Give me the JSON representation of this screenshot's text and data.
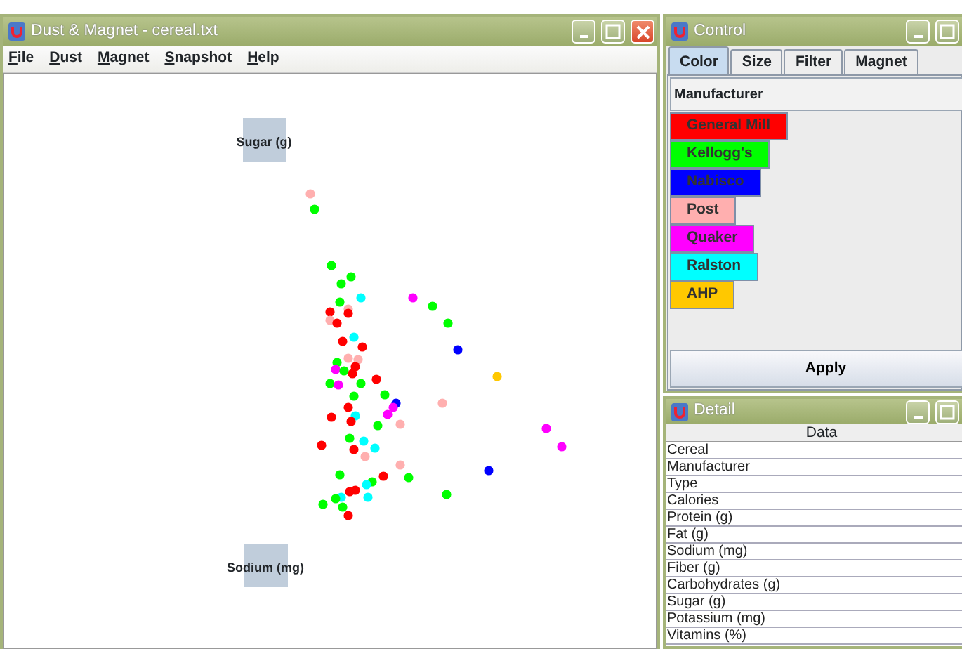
{
  "main_window": {
    "title": "Dust & Magnet - cereal.txt",
    "menu": [
      "File",
      "Dust",
      "Magnet",
      "Snapshot",
      "Help"
    ],
    "magnets": [
      {
        "label": "Sugar (g)"
      },
      {
        "label": "Sodium (mg)"
      }
    ]
  },
  "control_window": {
    "title": "Control",
    "tabs": [
      {
        "label": "Color",
        "selected": true
      },
      {
        "label": "Size",
        "selected": false
      },
      {
        "label": "Filter",
        "selected": false
      },
      {
        "label": "Magnet",
        "selected": false
      }
    ],
    "attribute": "Manufacturer",
    "legend": [
      {
        "label": "General Mill",
        "color": "#ff0000"
      },
      {
        "label": "Kellogg's",
        "color": "#00ff00"
      },
      {
        "label": "Nabisco",
        "color": "#0000ff"
      },
      {
        "label": "Post",
        "color": "#ffafaf"
      },
      {
        "label": "Quaker",
        "color": "#ff00ff"
      },
      {
        "label": "Ralston",
        "color": "#00ffff"
      },
      {
        "label": "AHP",
        "color": "#ffc800"
      }
    ],
    "apply": "Apply"
  },
  "detail_window": {
    "title": "Detail",
    "column": "Data",
    "rows": [
      "Cereal",
      "Manufacturer",
      "Type",
      "Calories",
      "Protein (g)",
      "Fat (g)",
      "Sodium (mg)",
      "Fiber (g)",
      "Carbohydrates (g)",
      "Sugar (g)",
      "Potassium (mg)",
      "Vitamins (%)"
    ]
  }
}
